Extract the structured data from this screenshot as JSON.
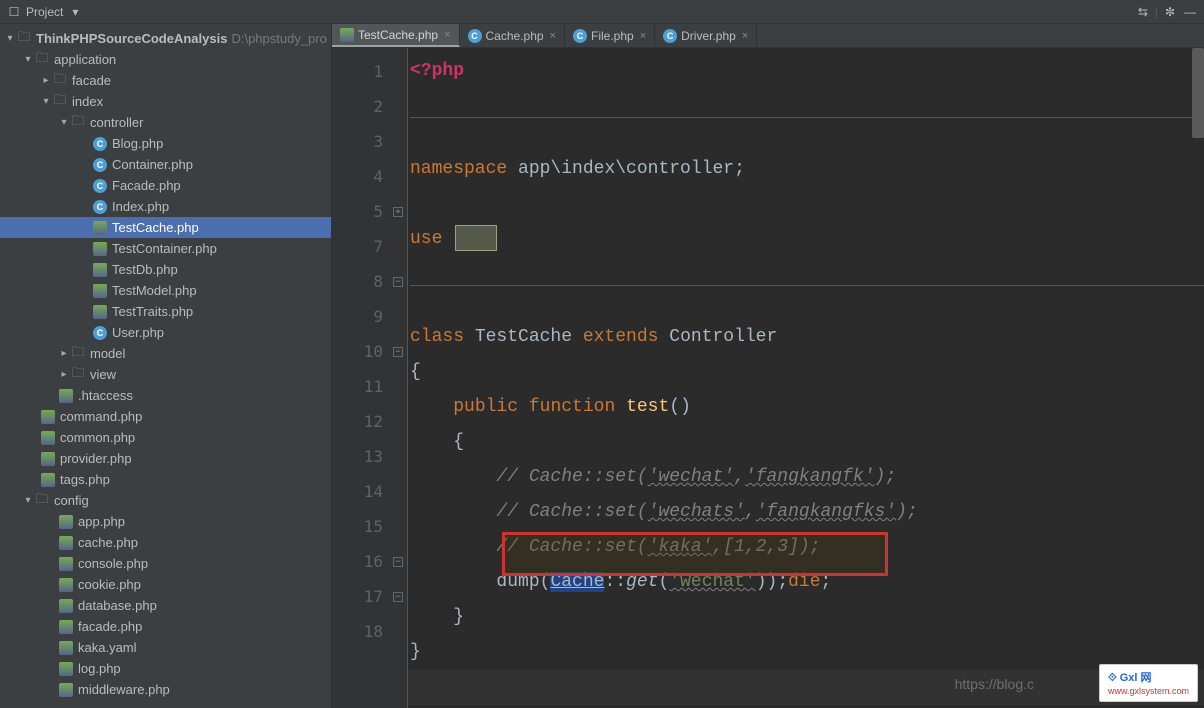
{
  "toolbar": {
    "project_label": "Project"
  },
  "tree": {
    "root": {
      "name": "ThinkPHPSourceCodeAnalysis",
      "path": "D:\\phpstudy_pro"
    },
    "app": "application",
    "facade": "facade",
    "index": "index",
    "controller": "controller",
    "files_ctrl": [
      "Blog.php",
      "Container.php",
      "Facade.php",
      "Index.php",
      "TestCache.php",
      "TestContainer.php",
      "TestDb.php",
      "TestModel.php",
      "TestTraits.php",
      "User.php"
    ],
    "model": "model",
    "view": "view",
    "htaccess": ".htaccess",
    "app_files": [
      "command.php",
      "common.php",
      "provider.php",
      "tags.php"
    ],
    "config": "config",
    "config_files": [
      "app.php",
      "cache.php",
      "console.php",
      "cookie.php",
      "database.php",
      "facade.php",
      "kaka.yaml",
      "log.php",
      "middleware.php"
    ]
  },
  "tabs": [
    {
      "label": "TestCache.php",
      "active": true,
      "icon": "php"
    },
    {
      "label": "Cache.php",
      "active": false,
      "icon": "c"
    },
    {
      "label": "File.php",
      "active": false,
      "icon": "c"
    },
    {
      "label": "Driver.php",
      "active": false,
      "icon": "c"
    }
  ],
  "code": {
    "l1": "<?php",
    "l3_ns": "namespace ",
    "l3_path": "app\\index\\controller",
    "l5_use": "use ",
    "l8_class": "class ",
    "l8_name": "TestCache ",
    "l8_ext": "extends ",
    "l8_ctrl": "Controller",
    "l10_pub": "public ",
    "l10_fn": "function ",
    "l10_name": "test",
    "l12_cmt": "// Cache::set('wechat','fangkangfk');",
    "l13_cmt": "// Cache::set('wechats','fangkangfks');",
    "l14_cmt": "// Cache::set('kaka',[1,2,3]);",
    "l15_dump": "dump",
    "l15_cache": "Cache",
    "l15_get": "get",
    "l15_str": "'wechat'",
    "l15_die": "die"
  },
  "footer": {
    "blog": "https://blog.c",
    "watermark": "Gxl 网",
    "watermark_url": "www.gxlsystem.com"
  }
}
